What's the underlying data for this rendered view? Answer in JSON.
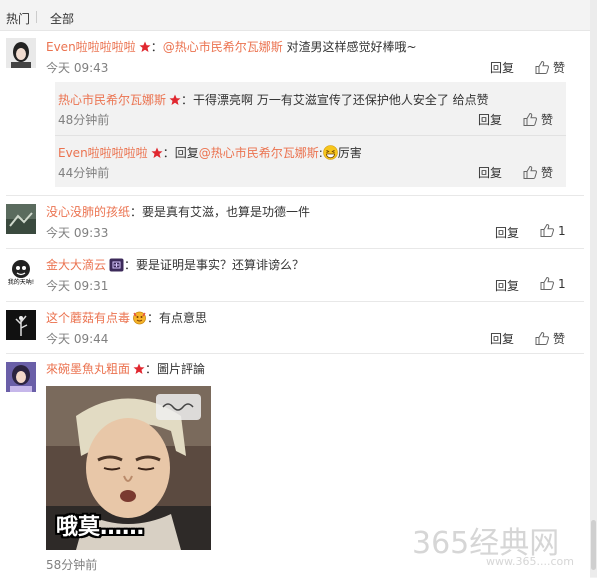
{
  "tabs": {
    "hot": "热门",
    "all": "全部"
  },
  "labels": {
    "reply": "回复",
    "like": "赞"
  },
  "comments": [
    {
      "user": "Even啦啦啦啦啦",
      "prefix": "：",
      "mention": "@热心市民希尔瓦娜斯",
      "text": " 对渣男这样感觉好棒哦~",
      "time": "今天 09:43",
      "likes": "赞"
    },
    {
      "user": "没心没肺的孩纸",
      "prefix": "：",
      "text": "要是真有艾滋，也算是功德一件",
      "time": "今天 09:33",
      "likes": "1"
    },
    {
      "user": "金大大滴云",
      "prefix": "：",
      "text": "要是证明是事实？还算诽谤么？",
      "time": "今天 09:31",
      "likes": "1",
      "avatar_caption": "我的天呐!"
    },
    {
      "user": "这个蘑菇有点毒",
      "prefix": "：",
      "text": "有点意思",
      "time": "今天 09:44",
      "likes": "赞"
    },
    {
      "user": "來碗墨魚丸粗面",
      "prefix": "：",
      "text": "圖片評論",
      "time": "58分钟前",
      "image_caption": "哦莫……"
    }
  ],
  "subreplies": [
    {
      "user": "热心市民希尔瓦娜斯",
      "prefix": "：",
      "text": "干得漂亮啊 万一有艾滋宣传了还保护他人安全了 给点赞",
      "time": "48分钟前",
      "likes": "赞"
    },
    {
      "user": "Even啦啦啦啦啦",
      "prefix": "：回复",
      "mention": "@热心市民希尔瓦娜斯",
      "text": ":",
      "suffix": "厉害",
      "time": "44分钟前",
      "likes": "赞"
    }
  ],
  "watermark": {
    "main": "365经典网",
    "sub": "www.365....com"
  },
  "colors": {
    "username": "#eb7350",
    "vip_badge": "#e0272f",
    "time": "#808080",
    "panel": "#ffffff",
    "background": "#f3f3f3"
  }
}
